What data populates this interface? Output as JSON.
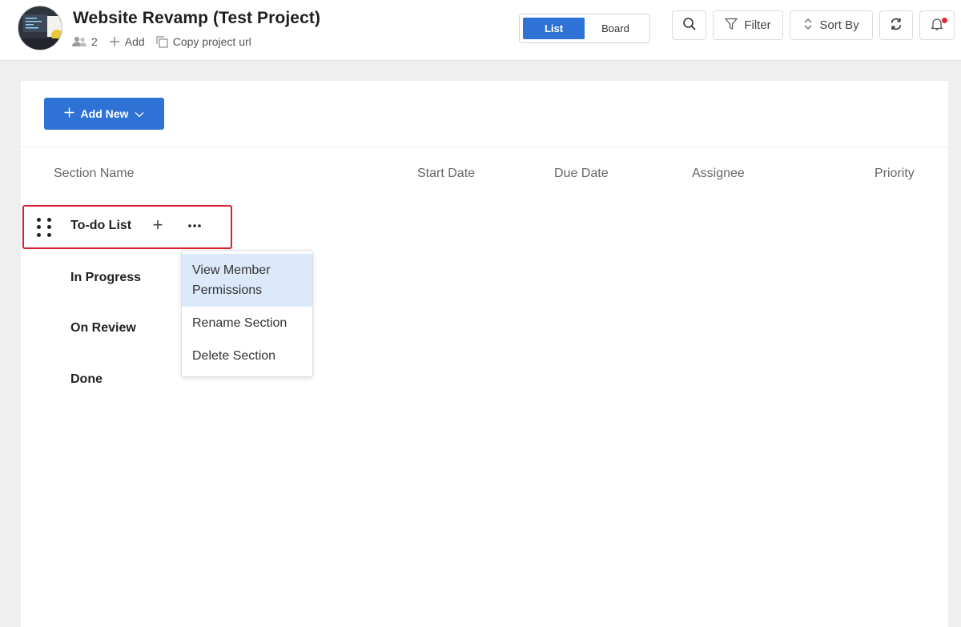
{
  "project": {
    "title": "Website Revamp (Test Project)",
    "member_count": "2",
    "add_label": "Add",
    "copy_url_label": "Copy project url"
  },
  "view_toggle": {
    "list_label": "List",
    "board_label": "Board",
    "active": "List"
  },
  "toolbar": {
    "filter_label": "Filter",
    "sort_label": "Sort By",
    "icons": [
      "search-icon",
      "filter-icon",
      "sort-icon",
      "refresh-icon",
      "bell-icon"
    ]
  },
  "add_new": {
    "label": "Add New"
  },
  "columns": [
    "Section Name",
    "Start Date",
    "Due Date",
    "Assignee",
    "Priority"
  ],
  "sections": [
    "To-do List",
    "In Progress",
    "On Review",
    "Done"
  ],
  "context_menu": {
    "items": [
      "View Member Permissions",
      "Rename Section",
      "Delete Section"
    ],
    "highlighted": "View Member Permissions"
  },
  "colors": {
    "accent": "#2f72d6",
    "highlight_border": "#d8222e",
    "notification_dot": "#e0283b",
    "menu_hover": "#dce9fb"
  }
}
